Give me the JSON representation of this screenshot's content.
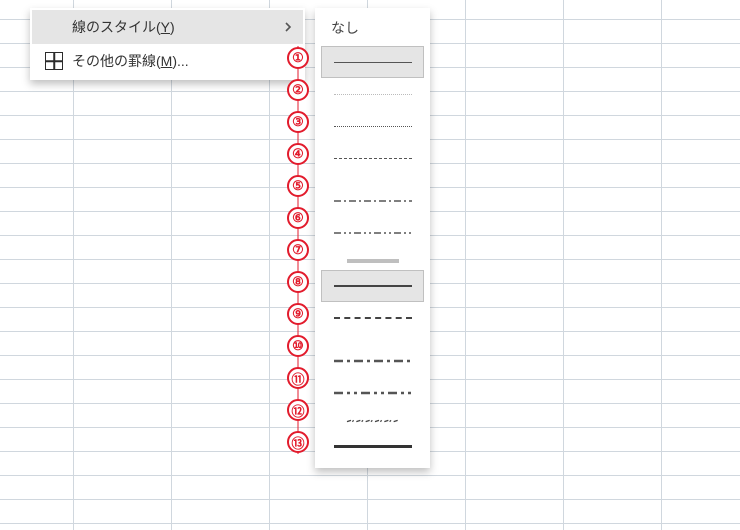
{
  "context": {
    "items": [
      {
        "label": "線のスタイル(",
        "hotkey": "Y",
        "tail": ")",
        "has_submenu": true,
        "icon": null,
        "highlight": true
      },
      {
        "label": "その他の罫線(",
        "hotkey": "M",
        "tail": ")...",
        "has_submenu": false,
        "icon": "borders-icon",
        "highlight": false
      }
    ]
  },
  "flyout": {
    "title": "なし",
    "items": [
      {
        "n": 1,
        "style": "thin-solid",
        "highlight": true
      },
      {
        "n": 2,
        "style": "hair",
        "highlight": false
      },
      {
        "n": 3,
        "style": "dot",
        "highlight": false
      },
      {
        "n": 4,
        "style": "dash",
        "highlight": false
      },
      {
        "n": 5,
        "style": "dash-dot",
        "highlight": false
      },
      {
        "n": 6,
        "style": "dash-dot-dot",
        "highlight": false
      },
      {
        "n": 7,
        "style": "double",
        "highlight": false
      },
      {
        "n": 8,
        "style": "med-solid",
        "highlight": true
      },
      {
        "n": 9,
        "style": "med-dash",
        "highlight": false
      },
      {
        "n": 10,
        "style": "med-dash-dot",
        "highlight": false
      },
      {
        "n": 11,
        "style": "med-dash-dot-dot",
        "highlight": false
      },
      {
        "n": 12,
        "style": "slant-dash-dot",
        "highlight": false
      },
      {
        "n": 13,
        "style": "thick-solid",
        "highlight": false
      }
    ]
  },
  "callouts": [
    "①",
    "②",
    "③",
    "④",
    "⑤",
    "⑥",
    "⑦",
    "⑧",
    "⑨",
    "⑩",
    "⑪",
    "⑫",
    "⑬"
  ],
  "colors": {
    "callout": "#e21b2c",
    "menu_highlight": "#e5e5e5"
  }
}
